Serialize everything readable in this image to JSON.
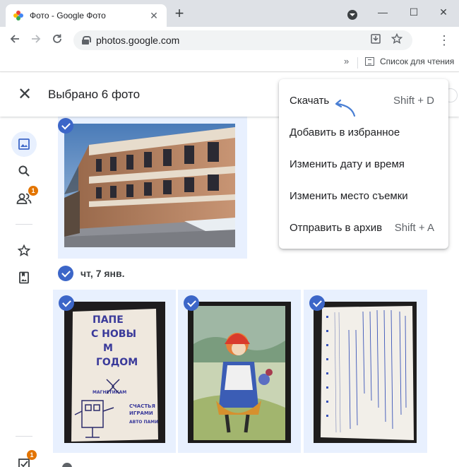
{
  "browser": {
    "tab_title": "Фото - Google Фото",
    "tab_close": "✕",
    "new_tab": "+",
    "url": "photos.google.com",
    "minimize": "—",
    "maximize": "☐",
    "close": "✕",
    "bookmarks_overflow": "»",
    "reading_list": "Список для чтения"
  },
  "header": {
    "close_icon": "✕",
    "title": "Выбрано 6 фото"
  },
  "sidebar": {
    "sharing_badge": "1",
    "bottom_badge": "1"
  },
  "content": {
    "date_label": "чт, 7 янв."
  },
  "menu": {
    "items": [
      {
        "label": "Скачать",
        "shortcut": "Shift + D"
      },
      {
        "label": "Добавить в избранное",
        "shortcut": ""
      },
      {
        "label": "Изменить дату и время",
        "shortcut": ""
      },
      {
        "label": "Изменить место съемки",
        "shortcut": ""
      },
      {
        "label": "Отправить в архив",
        "shortcut": "Shift + A"
      }
    ]
  },
  "colors": {
    "accent": "#3c66c8",
    "selection_bg": "#e8f0fe",
    "badge": "#e37400",
    "arrow": "#4a7fd4"
  },
  "photos": {
    "card1": [
      "ПАПЕ",
      "С НОВЫ",
      "М",
      "ГОДОМ",
      "МАГНЕТИКАМ",
      "СЧАСТЬЯ",
      "ИГРАМИ",
      "АВТО ПАМИ"
    ]
  }
}
